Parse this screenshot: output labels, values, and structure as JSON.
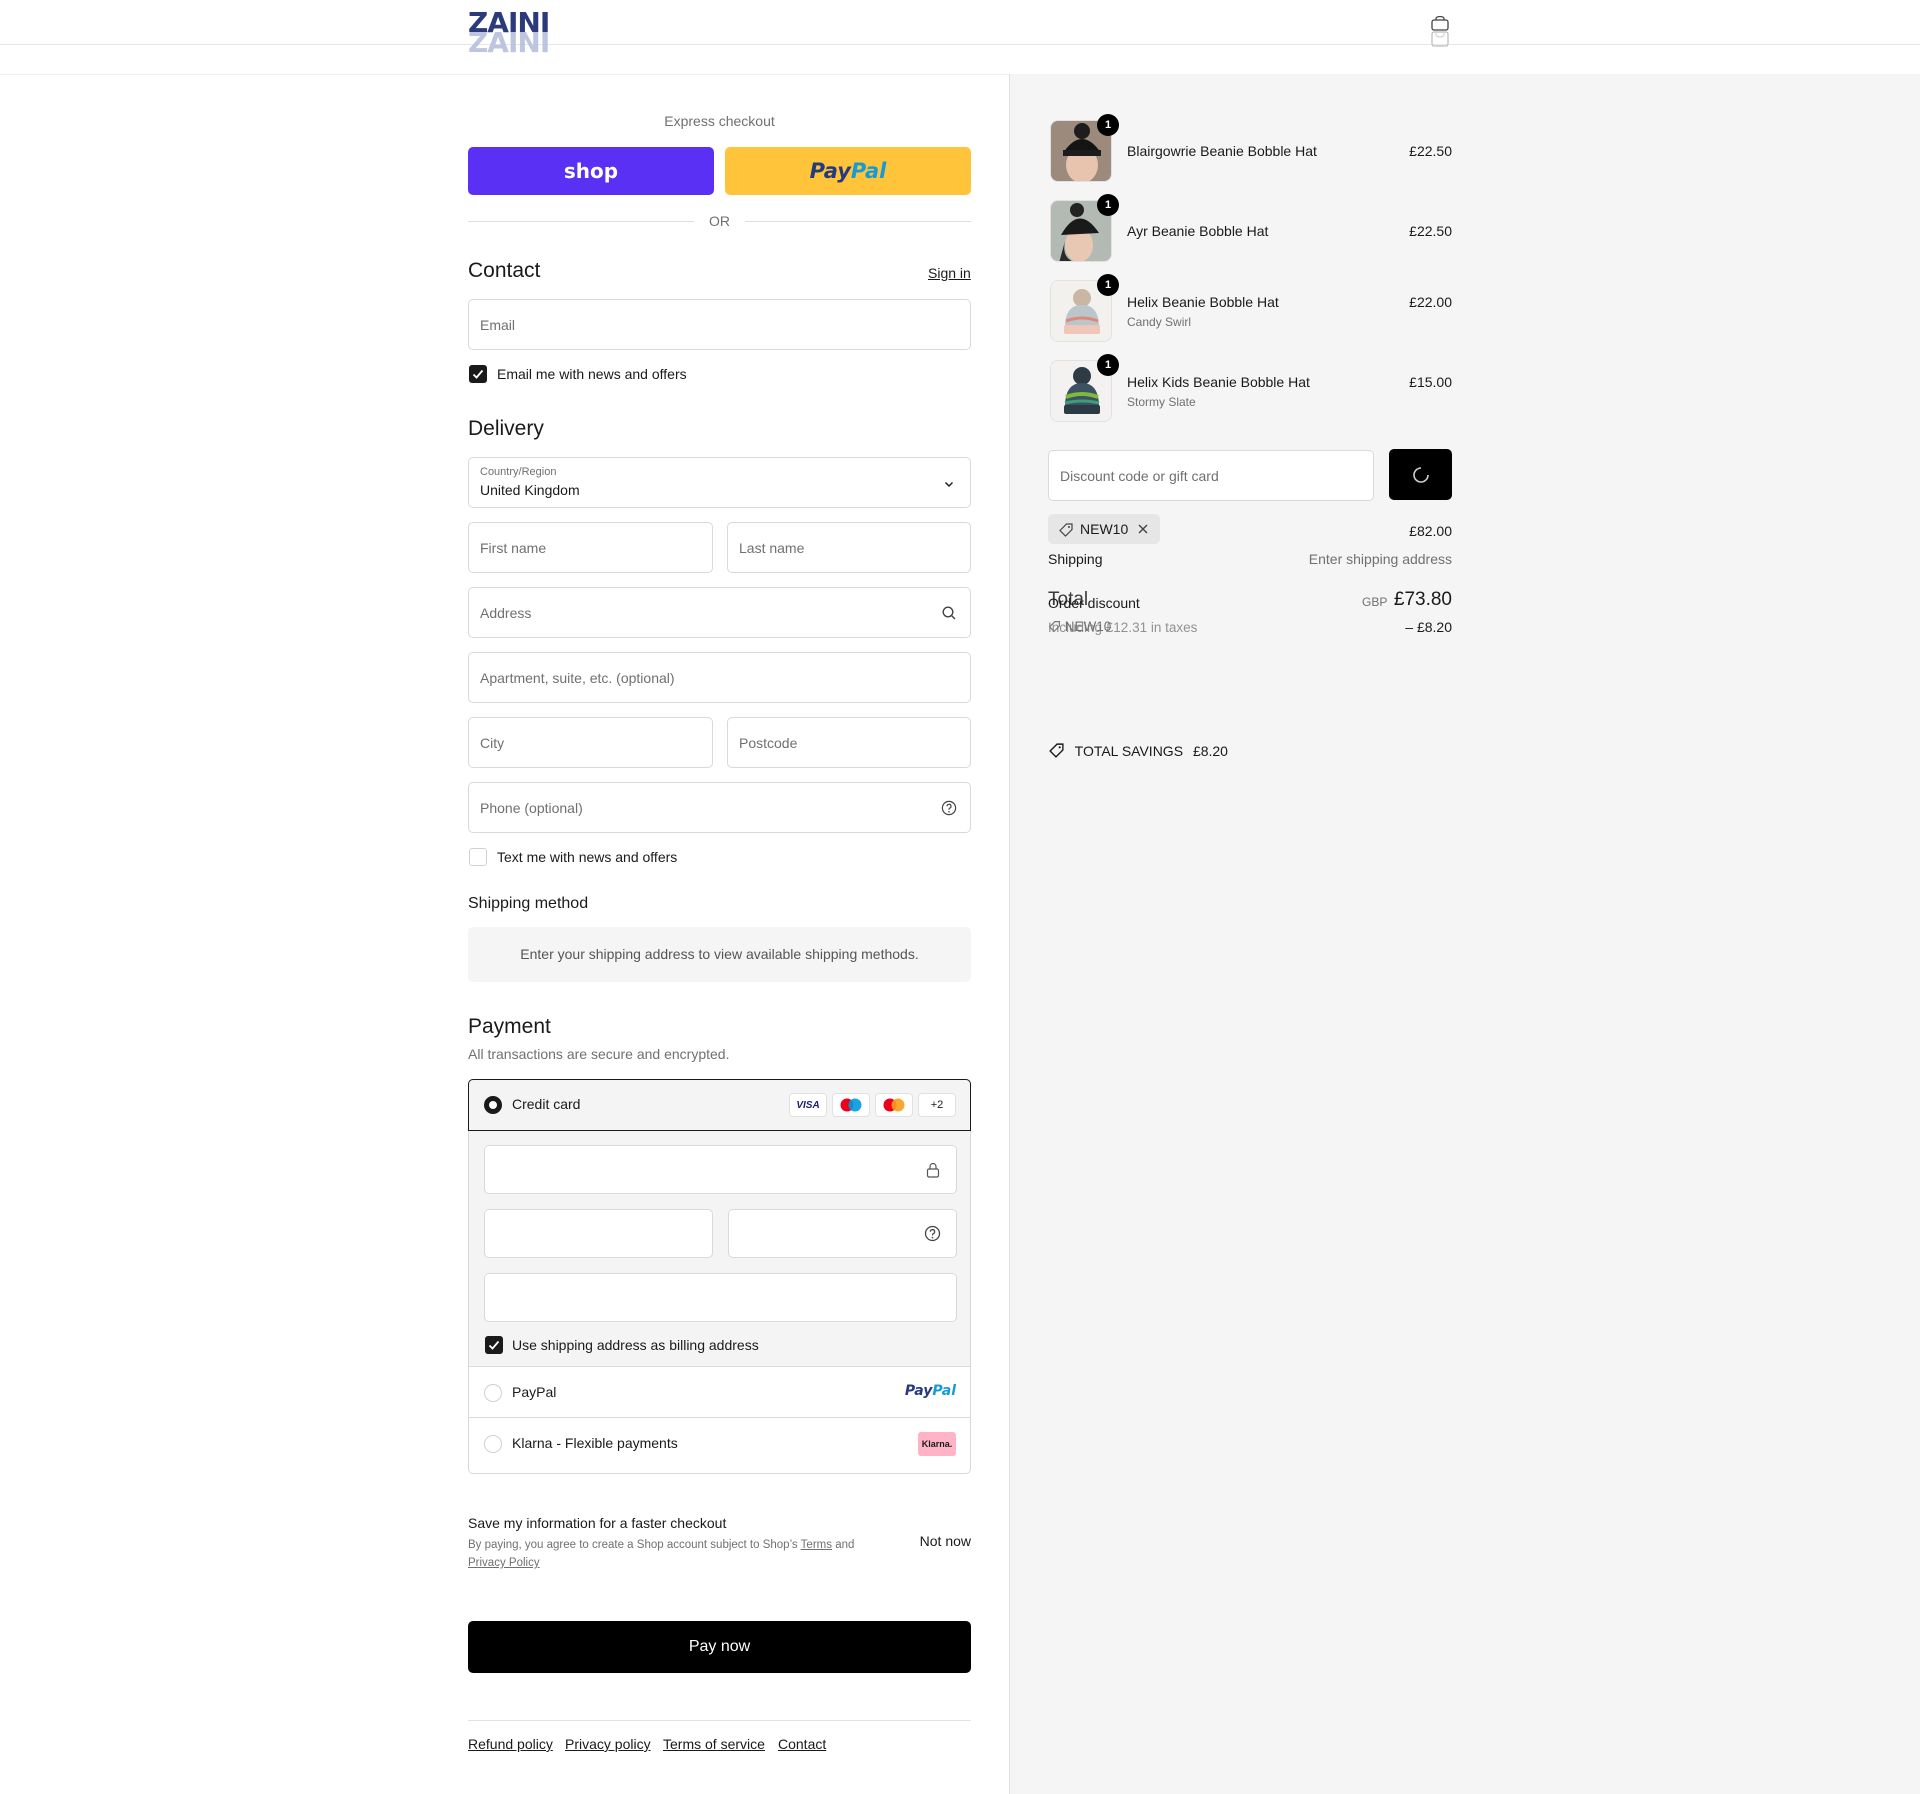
{
  "header": {
    "logo_text": "ZAINI"
  },
  "express": {
    "title": "Express checkout",
    "shop_label": "shop",
    "paypal_label_a": "Pay",
    "paypal_label_b": "Pal",
    "or_label": "OR"
  },
  "contact": {
    "title": "Contact",
    "sign_in": "Sign in",
    "email_placeholder": "Email",
    "news_label": "Email me with news and offers",
    "news_checked": true
  },
  "delivery": {
    "title": "Delivery",
    "country_label": "Country/Region",
    "country_value": "United Kingdom",
    "first_name": "First name",
    "last_name": "Last name",
    "address": "Address",
    "apartment": "Apartment, suite, etc. (optional)",
    "city": "City",
    "postcode": "Postcode",
    "phone": "Phone (optional)",
    "text_label": "Text me with news and offers",
    "text_checked": false
  },
  "shipping": {
    "title": "Shipping method",
    "notice": "Enter your shipping address to view available shipping methods."
  },
  "payment": {
    "title": "Payment",
    "subtitle": "All transactions are secure and encrypted.",
    "credit_card": "Credit card",
    "card_brands": [
      "VISA",
      "maestro",
      "mastercard"
    ],
    "more_brands": "+2",
    "billing_label": "Use shipping address as billing address",
    "paypal": "PayPal",
    "klarna": "Klarna - Flexible payments",
    "klarna_badge": "Klarna."
  },
  "save_info": {
    "title": "Save my information for a faster checkout",
    "legal_prefix": "By paying, you agree to create a Shop account subject to Shop’s",
    "terms": "Terms",
    "and": "and",
    "privacy": "Privacy Policy",
    "not_now": "Not now"
  },
  "pay_now": "Pay now",
  "footer_links": [
    "Refund policy",
    "Privacy policy",
    "Terms of service",
    "Contact"
  ],
  "summary": {
    "items": [
      {
        "name": "Blairgowrie Beanie Bobble Hat",
        "variant": "",
        "price": "£22.50",
        "qty": "1"
      },
      {
        "name": "Ayr Beanie Bobble Hat",
        "variant": "",
        "price": "£22.50",
        "qty": "1"
      },
      {
        "name": "Helix Beanie Bobble Hat",
        "variant": "Candy Swirl",
        "price": "£22.00",
        "qty": "1"
      },
      {
        "name": "Helix Kids Beanie Bobble Hat",
        "variant": "Stormy Slate",
        "price": "£15.00",
        "qty": "1"
      }
    ],
    "discount_placeholder": "Discount code or gift card",
    "code": "NEW10",
    "subtotal": "£82.00",
    "shipping_label": "Shipping",
    "shipping_value": "Enter shipping address",
    "order_discount": "Order discount",
    "code_tag": "NEW10",
    "discount_value": "– £8.20",
    "total_label": "Total",
    "currency": "GBP",
    "total": "£73.80",
    "taxes": "Including £12.31 in taxes",
    "savings_label": "TOTAL SAVINGS",
    "savings_value": "£8.20"
  },
  "colors": {
    "shop": "#5a31f4",
    "paypal": "#ffc439",
    "accent": "#1a1a1a"
  }
}
